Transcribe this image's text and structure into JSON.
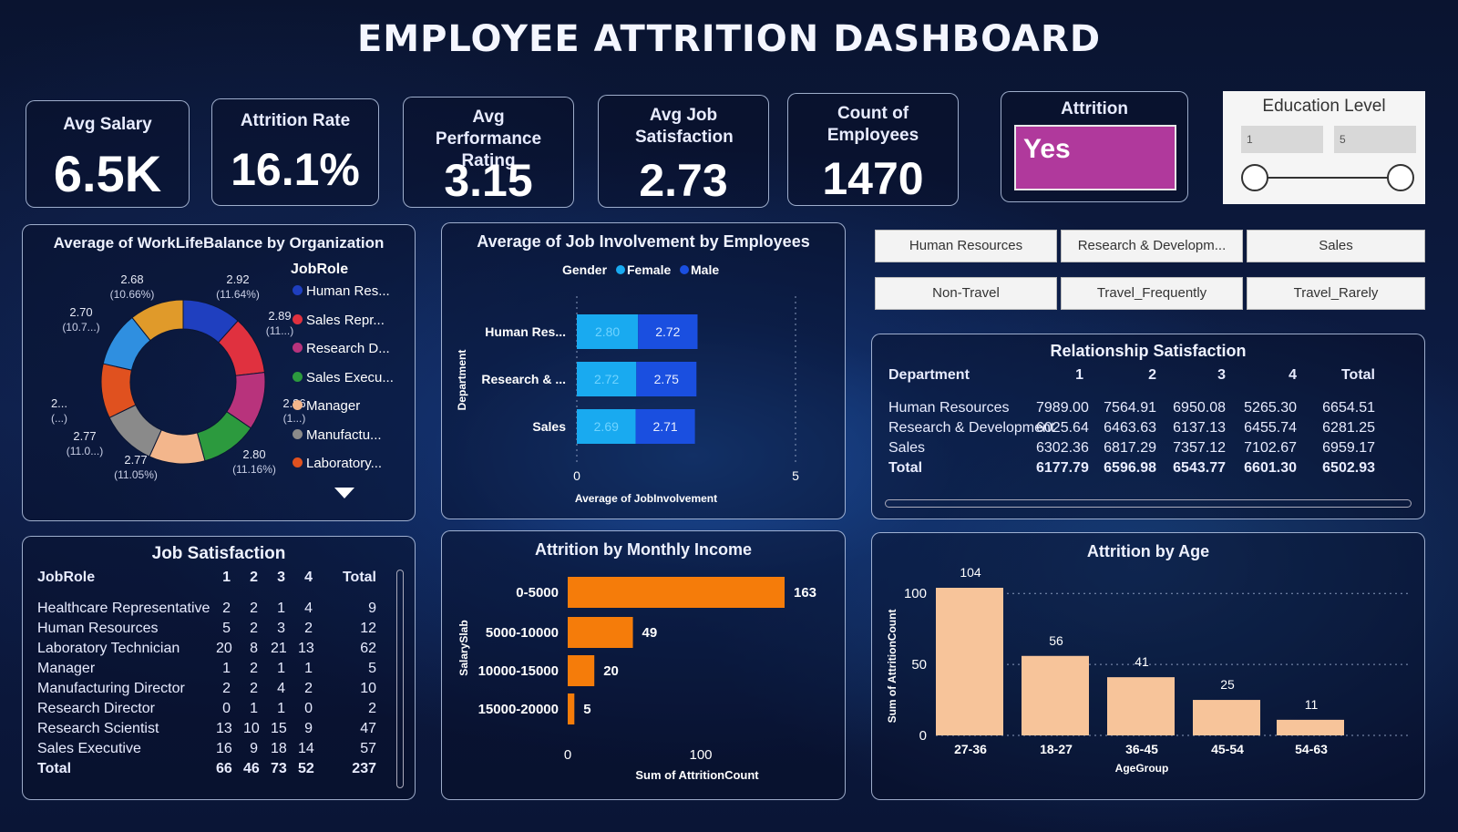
{
  "title": "EMPLOYEE ATTRITION DASHBOARD",
  "kpis": [
    {
      "label": "Avg Salary",
      "value": "6.5K"
    },
    {
      "label": "Attrition Rate",
      "value": "16.1%"
    },
    {
      "label": "Avg Performance Rating",
      "value": "3.15"
    },
    {
      "label": "Avg Job Satisfaction",
      "value": "2.73"
    },
    {
      "label": "Count of Employees",
      "value": "1470"
    }
  ],
  "attrition_slicer": {
    "label": "Attrition",
    "value": "Yes",
    "color": "#b0399c"
  },
  "education_slicer": {
    "label": "Education Level",
    "min": "1",
    "max": "5"
  },
  "dept_buttons": [
    "Human Resources",
    "Research & Developm...",
    "Sales"
  ],
  "travel_buttons": [
    "Non-Travel",
    "Travel_Frequently",
    "Travel_Rarely"
  ],
  "relationship": {
    "title": "Relationship Satisfaction",
    "headers": [
      "Department",
      "1",
      "2",
      "3",
      "4",
      "Total"
    ],
    "rows": [
      [
        "Human Resources",
        "7989.00",
        "7564.91",
        "6950.08",
        "5265.30",
        "6654.51"
      ],
      [
        "Research & Development",
        "6025.64",
        "6463.63",
        "6137.13",
        "6455.74",
        "6281.25"
      ],
      [
        "Sales",
        "6302.36",
        "6817.29",
        "7357.12",
        "7102.67",
        "6959.17"
      ]
    ],
    "total": [
      "Total",
      "6177.79",
      "6596.98",
      "6543.77",
      "6601.30",
      "6502.93"
    ]
  },
  "job_satisfaction": {
    "title": "Job Satisfaction",
    "headers": [
      "JobRole",
      "1",
      "2",
      "3",
      "4",
      "Total"
    ],
    "rows": [
      [
        "Healthcare Representative",
        "2",
        "2",
        "1",
        "4",
        "9"
      ],
      [
        "Human Resources",
        "5",
        "2",
        "3",
        "2",
        "12"
      ],
      [
        "Laboratory Technician",
        "20",
        "8",
        "21",
        "13",
        "62"
      ],
      [
        "Manager",
        "1",
        "2",
        "1",
        "1",
        "5"
      ],
      [
        "Manufacturing Director",
        "2",
        "2",
        "4",
        "2",
        "10"
      ],
      [
        "Research Director",
        "0",
        "1",
        "1",
        "0",
        "2"
      ],
      [
        "Research Scientist",
        "13",
        "10",
        "15",
        "9",
        "47"
      ],
      [
        "Sales Executive",
        "16",
        "9",
        "18",
        "14",
        "57"
      ]
    ],
    "total": [
      "Total",
      "66",
      "46",
      "73",
      "52",
      "237"
    ]
  },
  "chart_data": [
    {
      "type": "pie",
      "title": "Average of WorkLifeBalance by Organization",
      "legend_title": "JobRole",
      "legend": [
        {
          "name": "Human Res...",
          "color": "#1f3fbf"
        },
        {
          "name": "Sales Repr...",
          "color": "#e0313f"
        },
        {
          "name": "Research D...",
          "color": "#b8337c"
        },
        {
          "name": "Sales Execu...",
          "color": "#2c9a3e"
        },
        {
          "name": "Manager",
          "color": "#f3b68c"
        },
        {
          "name": "Manufactu...",
          "color": "#8a8a8a"
        },
        {
          "name": "Laboratory...",
          "color": "#e0511f"
        }
      ],
      "slices": [
        {
          "value": 2.92,
          "label": "2.92",
          "pct": "(11.64%)",
          "color": "#1f3fbf"
        },
        {
          "value": 2.89,
          "label": "2.89",
          "pct": "(11...)",
          "color": "#e0313f"
        },
        {
          "value": 2.86,
          "label": "2.86",
          "pct": "(1...)",
          "color": "#b8337c"
        },
        {
          "value": 2.8,
          "label": "2.80",
          "pct": "(11.16%)",
          "color": "#2c9a3e"
        },
        {
          "value": 2.77,
          "label": "2.77",
          "pct": "(11.05%)",
          "color": "#f3b68c"
        },
        {
          "value": 2.77,
          "label": "2.77",
          "pct": "(11.0...)",
          "color": "#8a8a8a"
        },
        {
          "value": 2.7,
          "label": "2...",
          "pct": "(...)",
          "color": "#e0511f"
        },
        {
          "value": 2.7,
          "label": "2.70",
          "pct": "(10.7...)",
          "color": "#2f8fe0"
        },
        {
          "value": 2.68,
          "label": "2.68",
          "pct": "(10.66%)",
          "color": "#e09a2a"
        }
      ]
    },
    {
      "type": "bar",
      "title": "Average of Job Involvement by Employees",
      "legend_title": "Gender",
      "categories": [
        "Human Res...",
        "Research & ...",
        "Sales"
      ],
      "series": [
        {
          "name": "Female",
          "color": "#19aaf0",
          "values": [
            2.8,
            2.72,
            2.69
          ]
        },
        {
          "name": "Male",
          "color": "#1a4fe0",
          "values": [
            2.72,
            2.75,
            2.71
          ]
        }
      ],
      "xlabel": "Average of JobInvolvement",
      "ylabel": "Department",
      "xlim": [
        0,
        5
      ],
      "xticks": [
        "0",
        "5"
      ]
    },
    {
      "type": "bar",
      "title": "Attrition by Monthly Income",
      "categories": [
        "0-5000",
        "5000-10000",
        "10000-15000",
        "15000-20000"
      ],
      "values": [
        163,
        49,
        20,
        5
      ],
      "color": "#f57c0a",
      "xlabel": "Sum of AttritionCount",
      "ylabel": "SalarySlab",
      "xlim": [
        0,
        163
      ],
      "xticks": [
        "0",
        "100"
      ]
    },
    {
      "type": "bar",
      "title": "Attrition by Age",
      "categories": [
        "27-36",
        "18-27",
        "36-45",
        "45-54",
        "54-63"
      ],
      "values": [
        104,
        56,
        41,
        25,
        11
      ],
      "color": "#f7c49a",
      "xlabel": "AgeGroup",
      "ylabel": "Sum of AttritionCount",
      "ylim": [
        0,
        104
      ],
      "yticks": [
        "0",
        "50",
        "100"
      ]
    }
  ]
}
